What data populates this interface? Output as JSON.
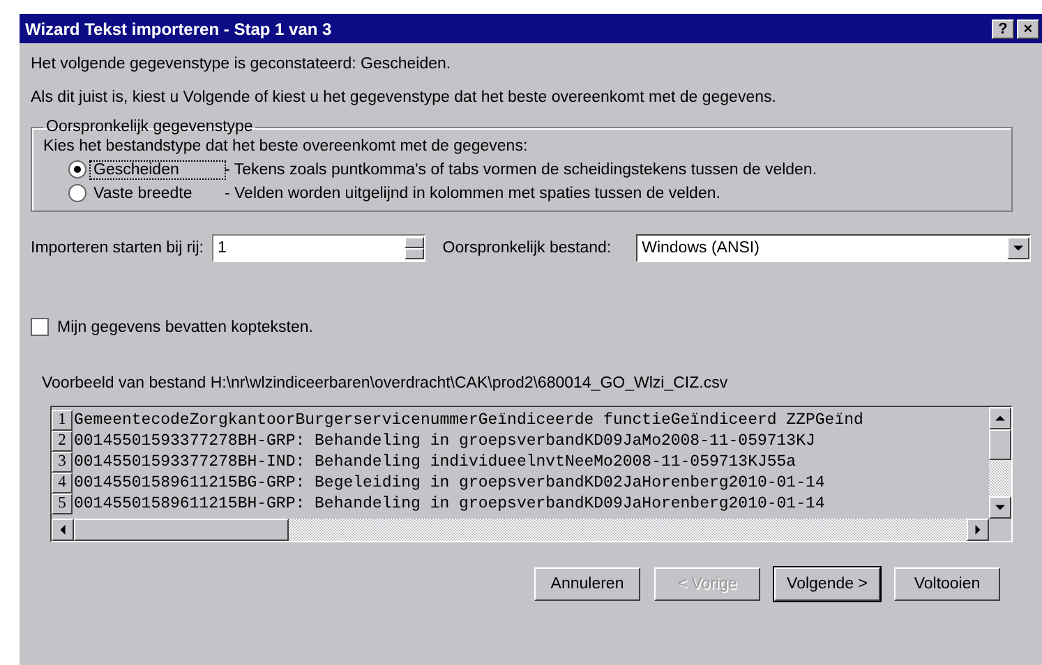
{
  "window": {
    "title": "Wizard Tekst importeren - Stap 1 van 3",
    "help": "?",
    "close": "×"
  },
  "intro": [
    "Het volgende gegevenstype is geconstateerd: Gescheiden.",
    "Als dit juist is, kiest u Volgende of kiest u het gegevenstype dat het beste overeenkomt met de gegevens."
  ],
  "group": {
    "legend": "Oorspronkelijk gegevenstype",
    "prompt": "Kies het bestandstype dat het beste overeenkomt met de gegevens:",
    "options": [
      {
        "label": "Gescheiden",
        "description": "- Tekens zoals puntkomma's of tabs vormen de scheidingstekens tussen de velden.",
        "selected": true
      },
      {
        "label": "Vaste breedte",
        "description": "- Velden worden uitgelijnd in kolommen met spaties tussen de velden.",
        "selected": false
      }
    ]
  },
  "start_row": {
    "label": "Importeren starten bij rij:",
    "value": "1"
  },
  "origin": {
    "label": "Oorspronkelijk bestand:",
    "value": "Windows (ANSI)"
  },
  "headers_checkbox": {
    "label": "Mijn gegevens bevatten kopteksten.",
    "checked": false
  },
  "preview": {
    "label": "Voorbeeld van bestand H:\\nr\\wlzindiceerbaren\\overdracht\\CAK\\prod2\\680014_GO_Wlzi_CIZ.csv",
    "rows": [
      {
        "number": "1",
        "text": "GemeentecodeZorgkantoorBurgerservicenummerGeïndiceerde functieGeïndiceerd ZZPGeïnd"
      },
      {
        "number": "2",
        "text": "00145501593377278BH-GRP: Behandeling in groepsverbandKD09JaMo2008-11-059713KJ"
      },
      {
        "number": "3",
        "text": "00145501593377278BH-IND: Behandeling individueelnvtNeeMo2008-11-059713KJ55a"
      },
      {
        "number": "4",
        "text": "00145501589611215BG-GRP: Begeleiding in groepsverbandKD02JaHorenberg2010-01-14"
      },
      {
        "number": "5",
        "text": "00145501589611215BH-GRP: Behandeling in groepsverbandKD09JaHorenberg2010-01-14"
      }
    ]
  },
  "buttons": [
    {
      "label": "Annuleren",
      "disabled": false,
      "default": false
    },
    {
      "label": "< Vorige",
      "disabled": true,
      "default": false
    },
    {
      "label": "Volgende >",
      "disabled": false,
      "default": true
    },
    {
      "label": "Voltooien",
      "disabled": false,
      "default": false
    }
  ]
}
